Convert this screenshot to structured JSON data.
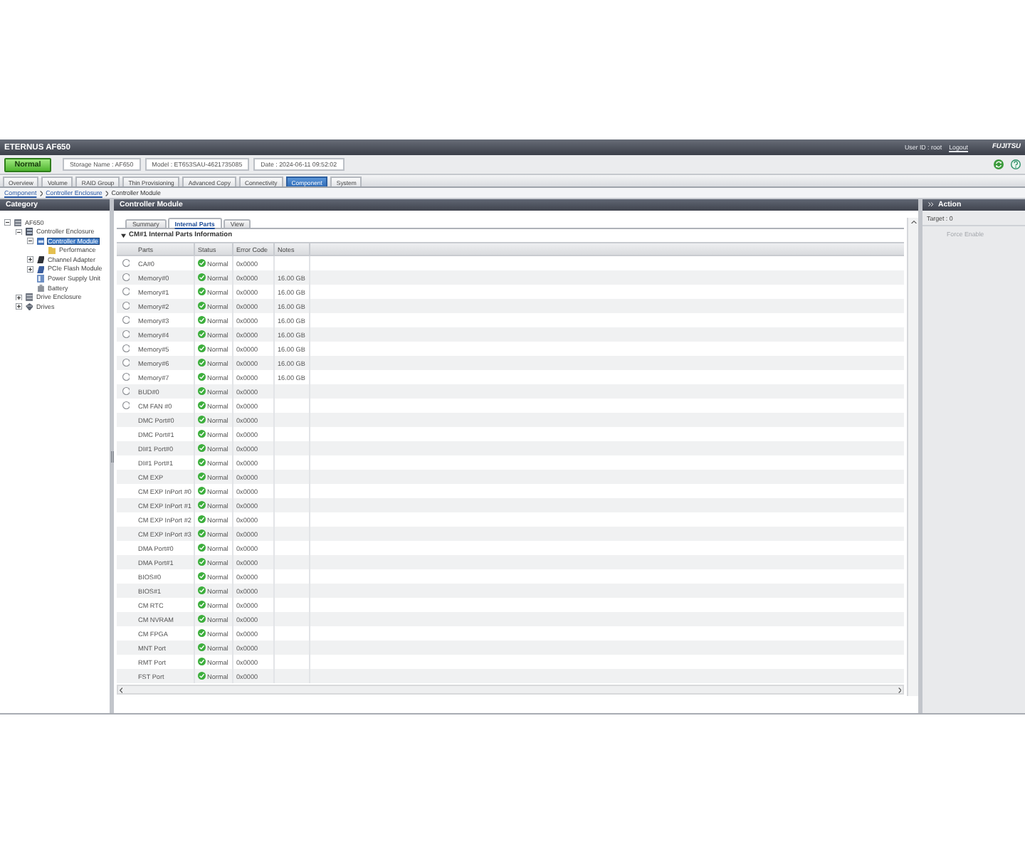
{
  "header": {
    "product": "ETERNUS AF650",
    "user": "User ID : root",
    "logout": "Logout",
    "logo": "FUJITSU"
  },
  "status_bar": {
    "status": "Normal",
    "storage_name": "Storage Name : AF650",
    "model": "Model : ET653SAU-4621735085",
    "date": "Date : 2024-06-11 09:52:02"
  },
  "tabs": [
    {
      "label": "Overview",
      "selected": false
    },
    {
      "label": "Volume",
      "selected": false
    },
    {
      "label": "RAID Group",
      "selected": false
    },
    {
      "label": "Thin Provisioning",
      "selected": false
    },
    {
      "label": "Advanced Copy",
      "selected": false
    },
    {
      "label": "Connectivity",
      "selected": false
    },
    {
      "label": "Component",
      "selected": true
    },
    {
      "label": "System",
      "selected": false
    }
  ],
  "breadcrumb": [
    "Component",
    "Controller Enclosure",
    "Controller Module"
  ],
  "category": {
    "title": "Category",
    "tree": [
      {
        "label": "AF650",
        "kind": "storage",
        "expanded": true,
        "selected": false,
        "children": [
          {
            "label": "Controller Enclosure",
            "kind": "enclosure",
            "expanded": true,
            "selected": false,
            "children": [
              {
                "label": "Controller Module",
                "kind": "module",
                "expanded": true,
                "selected": true,
                "children": [
                  {
                    "label": "Performance",
                    "kind": "folder",
                    "selected": false
                  }
                ]
              },
              {
                "label": "Channel Adapter",
                "kind": "adapter",
                "expanded": false,
                "selected": false
              },
              {
                "label": "PCIe Flash Module",
                "kind": "flash",
                "expanded": false,
                "selected": false
              },
              {
                "label": "Power Supply Unit",
                "kind": "power",
                "selected": false
              },
              {
                "label": "Battery",
                "kind": "battery",
                "selected": false
              }
            ]
          },
          {
            "label": "Drive Enclosure",
            "kind": "drive-enclosure",
            "expanded": false,
            "selected": false
          },
          {
            "label": "Drives",
            "kind": "drives",
            "expanded": false,
            "selected": false
          }
        ]
      }
    ]
  },
  "main": {
    "title": "Controller Module",
    "subtabs": [
      {
        "label": "Summary",
        "selected": false
      },
      {
        "label": "Internal Parts",
        "selected": true
      },
      {
        "label": "View",
        "selected": false
      }
    ],
    "section": {
      "title": "CM#1 Internal Parts Information",
      "expanded": true
    },
    "columns": [
      "Parts",
      "Status",
      "Error Code",
      "Notes"
    ],
    "rows": [
      {
        "parts": "CA#0",
        "status": "Normal",
        "error_code": "0x0000",
        "selected": false
      },
      {
        "parts": "Memory#0",
        "status": "Normal",
        "error_code": "0x0000",
        "notes": "16.00 GB",
        "selected": false
      },
      {
        "parts": "Memory#1",
        "status": "Normal",
        "error_code": "0x0000",
        "notes": "16.00 GB",
        "selected": false
      },
      {
        "parts": "Memory#2",
        "status": "Normal",
        "error_code": "0x0000",
        "notes": "16.00 GB",
        "selected": false
      },
      {
        "parts": "Memory#3",
        "status": "Normal",
        "error_code": "0x0000",
        "notes": "16.00 GB",
        "selected": false
      },
      {
        "parts": "Memory#4",
        "status": "Normal",
        "error_code": "0x0000",
        "notes": "16.00 GB",
        "selected": false
      },
      {
        "parts": "Memory#5",
        "status": "Normal",
        "error_code": "0x0000",
        "notes": "16.00 GB",
        "selected": false
      },
      {
        "parts": "Memory#6",
        "status": "Normal",
        "error_code": "0x0000",
        "notes": "16.00 GB",
        "selected": false
      },
      {
        "parts": "Memory#7",
        "status": "Normal",
        "error_code": "0x0000",
        "notes": "16.00 GB",
        "selected": false
      },
      {
        "parts": "BUD#0",
        "status": "Normal",
        "error_code": "0x0000",
        "selected": false
      },
      {
        "parts": "CM FAN #0",
        "status": "Normal",
        "error_code": "0x0000",
        "selected": false
      },
      {
        "parts": "DMC Port#0",
        "status": "Normal",
        "error_code": "0x0000"
      },
      {
        "parts": "DMC Port#1",
        "status": "Normal",
        "error_code": "0x0000"
      },
      {
        "parts": "DI#1 Port#0",
        "status": "Normal",
        "error_code": "0x0000"
      },
      {
        "parts": "DI#1 Port#1",
        "status": "Normal",
        "error_code": "0x0000"
      },
      {
        "parts": "CM EXP",
        "status": "Normal",
        "error_code": "0x0000"
      },
      {
        "parts": "CM EXP InPort #0",
        "status": "Normal",
        "error_code": "0x0000"
      },
      {
        "parts": "CM EXP InPort #1",
        "status": "Normal",
        "error_code": "0x0000"
      },
      {
        "parts": "CM EXP InPort #2",
        "status": "Normal",
        "error_code": "0x0000"
      },
      {
        "parts": "CM EXP InPort #3",
        "status": "Normal",
        "error_code": "0x0000"
      },
      {
        "parts": "DMA Port#0",
        "status": "Normal",
        "error_code": "0x0000"
      },
      {
        "parts": "DMA Port#1",
        "status": "Normal",
        "error_code": "0x0000"
      },
      {
        "parts": "BIOS#0",
        "status": "Normal",
        "error_code": "0x0000"
      },
      {
        "parts": "BIOS#1",
        "status": "Normal",
        "error_code": "0x0000"
      },
      {
        "parts": "CM RTC",
        "status": "Normal",
        "error_code": "0x0000"
      },
      {
        "parts": "CM NVRAM",
        "status": "Normal",
        "error_code": "0x0000"
      },
      {
        "parts": "CM FPGA",
        "status": "Normal",
        "error_code": "0x0000"
      },
      {
        "parts": "MNT Port",
        "status": "Normal",
        "error_code": "0x0000"
      },
      {
        "parts": "RMT Port",
        "status": "Normal",
        "error_code": "0x0000"
      },
      {
        "parts": "FST Port",
        "status": "Normal",
        "error_code": "0x0000"
      }
    ]
  },
  "action": {
    "title": "Action",
    "target": "Target : 0",
    "items": [
      {
        "label": "Force Enable",
        "disabled": true
      }
    ]
  }
}
